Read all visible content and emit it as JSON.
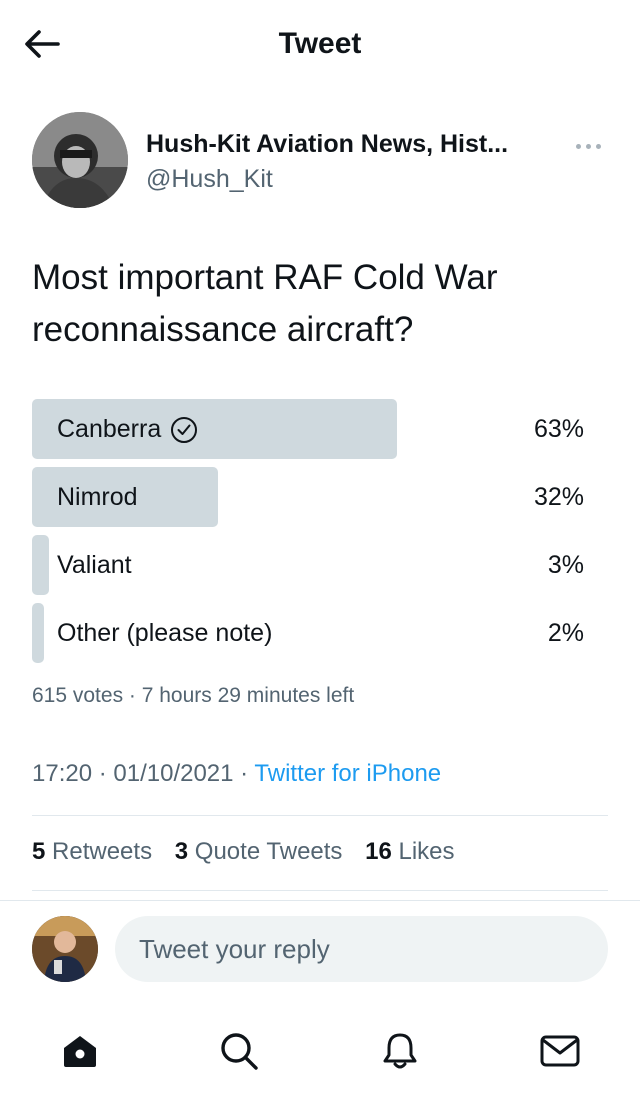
{
  "header": {
    "title": "Tweet",
    "back_icon": "arrow-left-icon"
  },
  "author": {
    "name": "Hush-Kit Aviation News, Hist...",
    "handle": "@Hush_Kit"
  },
  "tweet": {
    "text": "Most important RAF Cold War reconnaissance aircraft?"
  },
  "poll": {
    "options": [
      {
        "label": "Canberra",
        "percent_text": "63%",
        "percent": 63,
        "winner": true
      },
      {
        "label": "Nimrod",
        "percent_text": "32%",
        "percent": 32,
        "winner": false
      },
      {
        "label": "Valiant",
        "percent_text": "3%",
        "percent": 3,
        "winner": false
      },
      {
        "label": "Other (please note)",
        "percent_text": "2%",
        "percent": 2,
        "winner": false
      }
    ],
    "meta": "615 votes · 7 hours 29 minutes left"
  },
  "timestamp": {
    "time_date": "17:20 · 01/10/2021 · ",
    "source": "Twitter for iPhone"
  },
  "stats": {
    "retweets_count": "5",
    "retweets_label": "Retweets",
    "quotes_count": "3",
    "quotes_label": "Quote Tweets",
    "likes_count": "16",
    "likes_label": "Likes"
  },
  "reply": {
    "placeholder": "Tweet your reply"
  },
  "tabbar": {
    "icons": [
      "home-icon",
      "search-icon",
      "notifications-icon",
      "messages-icon"
    ]
  },
  "colors": {
    "accent": "#1d9bf0",
    "poll_bar": "#cfd9de",
    "muted_text": "#536471",
    "primary_text": "#0f1419"
  }
}
